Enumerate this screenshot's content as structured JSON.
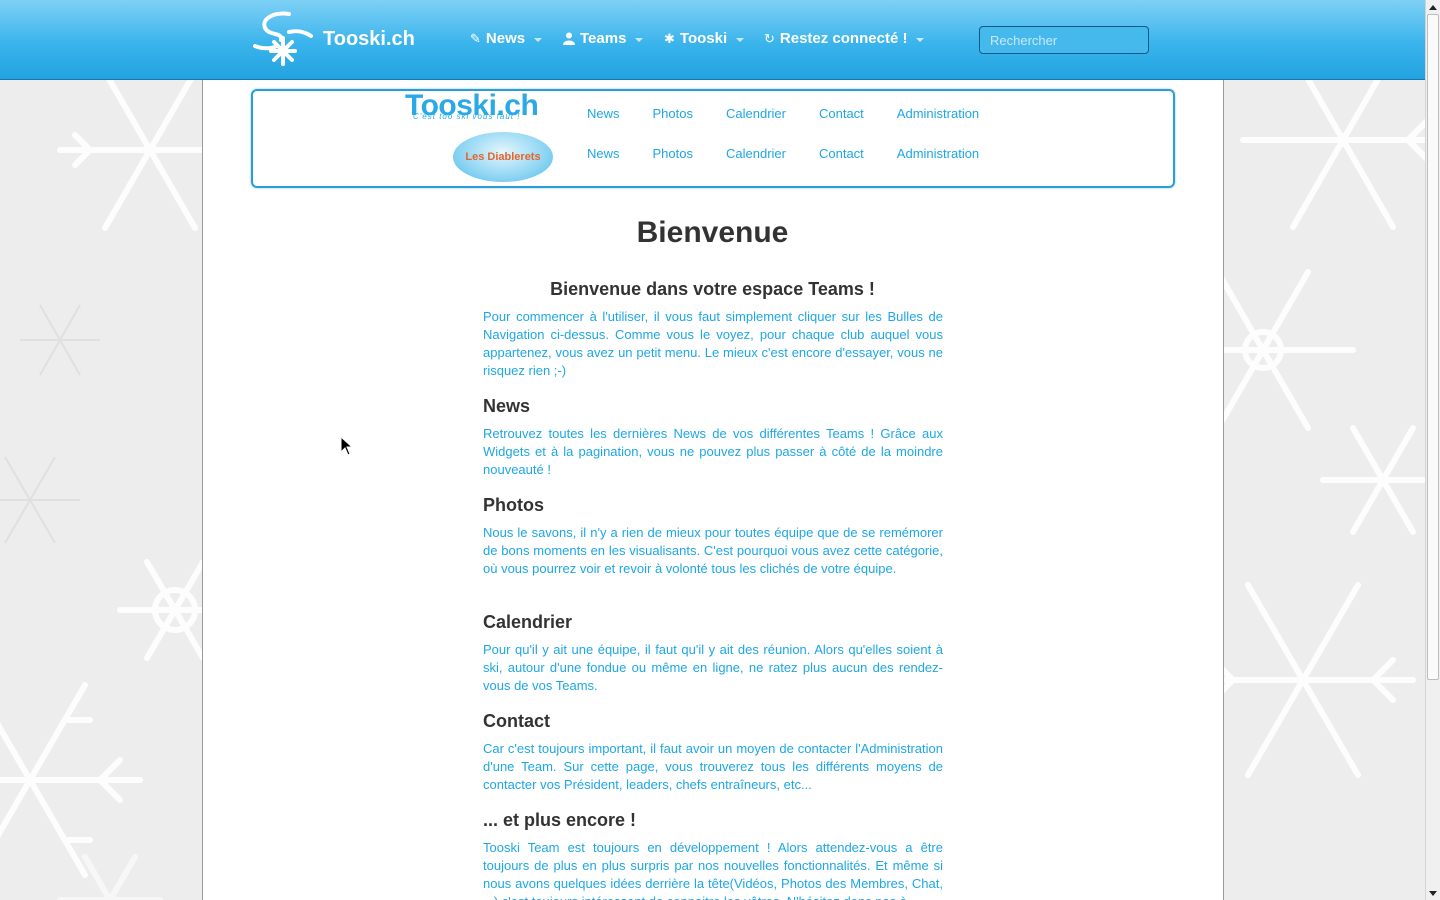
{
  "navbar": {
    "brand": "Tooski.ch",
    "items": [
      {
        "label": "News",
        "icon": "pencil-icon"
      },
      {
        "label": "Teams",
        "icon": "user-icon"
      },
      {
        "label": "Tooski",
        "icon": "asterisk-icon"
      },
      {
        "label": "Restez connecté !",
        "icon": "refresh-icon"
      }
    ],
    "search_placeholder": "Rechercher"
  },
  "teams_bar": {
    "logo_title": "Tooski.ch",
    "logo_tagline": "C'est too ski vous faut !",
    "team_name": "Les Diablerets",
    "row1": [
      "News",
      "Photos",
      "Calendrier",
      "Contact",
      "Administration"
    ],
    "row2": [
      "News",
      "Photos",
      "Calendrier",
      "Contact",
      "Administration"
    ]
  },
  "main": {
    "title": "Bienvenue",
    "subtitle": "Bienvenue dans votre espace Teams !",
    "intro": "Pour commencer à l'utiliser, il vous faut simplement cliquer sur les Bulles de Navigation ci-dessus. Comme vous le voyez, pour chaque club auquel vous appartenez, vous avez un petit menu. Le mieux c'est encore d'essayer, vous ne risquez rien ;-)",
    "sections": [
      {
        "heading": "News",
        "text": "Retrouvez toutes les dernières News de vos différentes Teams ! Grâce aux Widgets et à la pagination, vous ne pouvez plus passer à côté de la moindre nouveauté !"
      },
      {
        "heading": "Photos",
        "text": "Nous le savons, il n'y a rien de mieux pour toutes équipe que de se remémorer de bons moments en les visualisants. C'est pourquoi vous avez cette catégorie, où vous pourrez voir et revoir à volonté tous les clichés de votre équipe."
      },
      {
        "heading": "Calendrier",
        "text": "Pour qu'il y ait une équipe, il faut qu'il y ait des réunion. Alors qu'elles soient à ski, autour d'une fondue ou même en ligne, ne ratez plus aucun des rendez-vous de vos Teams."
      },
      {
        "heading": "Contact",
        "text": "Car c'est toujours important, il faut avoir un moyen de contacter l'Administration d'une Team. Sur cette page, vous trouverez tous les différents moyens de contacter vos Président, leaders, chefs entraîneurs, etc..."
      },
      {
        "heading": "... et plus encore !",
        "text": "Tooski Team est toujours en développement ! Alors attendez-vous a être toujours de plus en plus surpris par nos nouvelles fonctionnalités. Et même si nous avons quelques idées derrière la tête(Vidéos, Photos des Membres, Chat, ...) c'est toujours intéressant de connaitre les vôtres. N'hésitez donc pas à"
      }
    ]
  }
}
